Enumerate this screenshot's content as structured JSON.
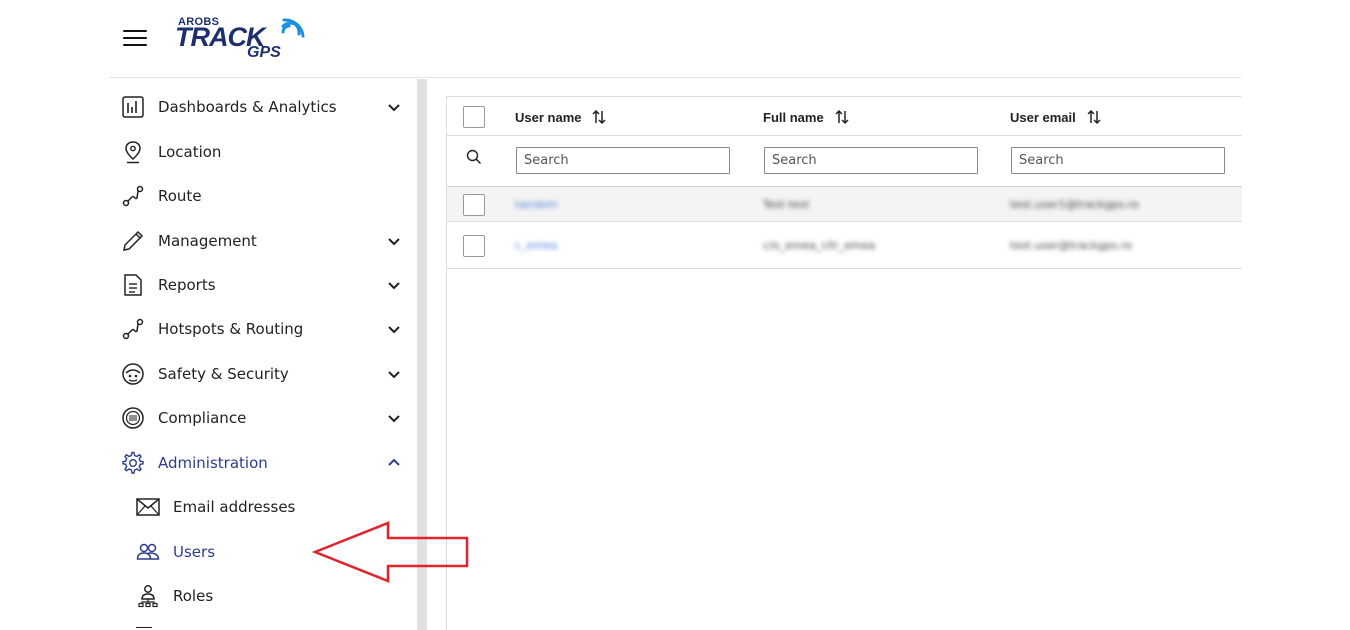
{
  "header": {
    "logo": {
      "line1": "AROBS",
      "line2": "TRACK",
      "line3": "GPS"
    }
  },
  "sidebar": {
    "items": [
      {
        "label": "Dashboards & Analytics",
        "icon": "bar-chart-icon",
        "expandable": true
      },
      {
        "label": "Location",
        "icon": "map-pin-icon",
        "expandable": false
      },
      {
        "label": "Route",
        "icon": "route-icon",
        "expandable": false
      },
      {
        "label": "Management",
        "icon": "pencil-icon",
        "expandable": true
      },
      {
        "label": "Reports",
        "icon": "document-icon",
        "expandable": true
      },
      {
        "label": "Hotspots & Routing",
        "icon": "route-icon",
        "expandable": true
      },
      {
        "label": "Safety & Security",
        "icon": "safety-icon",
        "expandable": true
      },
      {
        "label": "Compliance",
        "icon": "compliance-icon",
        "expandable": true
      },
      {
        "label": "Administration",
        "icon": "gear-icon",
        "expandable": true,
        "expanded": true
      }
    ],
    "subitems": [
      {
        "label": "Email addresses",
        "icon": "envelope-icon"
      },
      {
        "label": "Users",
        "icon": "users-icon",
        "active": true
      },
      {
        "label": "Roles",
        "icon": "roles-icon"
      }
    ],
    "active_color": "#2c3e8c"
  },
  "table": {
    "columns": [
      {
        "label": "User name"
      },
      {
        "label": "Full name"
      },
      {
        "label": "User email"
      }
    ],
    "search_placeholder": "Search",
    "rows": [
      {
        "username": "tandem",
        "fullname": "Test test",
        "email": "test.user1@trackgps.ro"
      },
      {
        "username": "c_emea",
        "fullname": "c/o_emea_r/tr_emea",
        "email": "test.user@trackgps.ro"
      }
    ]
  },
  "annotation": {
    "arrow_color": "#e0242a"
  }
}
